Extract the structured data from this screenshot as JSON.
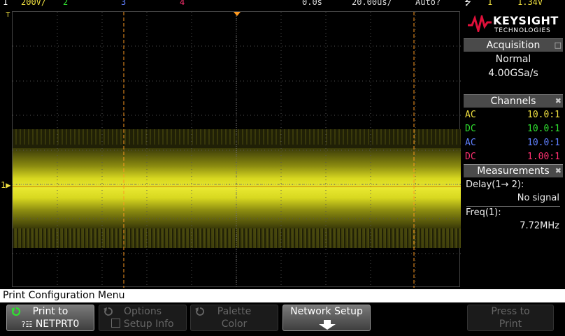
{
  "status": {
    "ch1_scale": "200V/",
    "ch2_label": "2",
    "ch3_label": "3",
    "ch4_label": "4",
    "delay": "0.0s",
    "timebase": "20.00us/",
    "trigger_mode": "Auto?",
    "trigger_source": "1",
    "trigger_level": "1.34V"
  },
  "brand": {
    "name": "KEYSIGHT",
    "sub": "TECHNOLOGIES"
  },
  "acquisition": {
    "title": "Acquisition",
    "mode": "Normal",
    "rate": "4.00GSa/s"
  },
  "channels": {
    "title": "Channels",
    "rows": [
      {
        "coupling": "AC",
        "probe": "10.0:1",
        "color": "#f0e040"
      },
      {
        "coupling": "DC",
        "probe": "10.0:1",
        "color": "#30e030"
      },
      {
        "coupling": "AC",
        "probe": "10.0:1",
        "color": "#6080ff"
      },
      {
        "coupling": "DC",
        "probe": "1.00:1",
        "color": "#ff3070"
      }
    ]
  },
  "measurements": {
    "title": "Measurements",
    "delay_label": "Delay(1→ 2):",
    "delay_value": "No signal",
    "freq_label": "Freq(1):",
    "freq_value": "7.72MHz"
  },
  "menu": {
    "title": "Print Configuration Menu",
    "print_to_label": "Print to",
    "print_to_value": "NETPRT0",
    "options_label": "Options",
    "setup_info_label": "Setup Info",
    "palette_label": "Palette",
    "palette_value": "Color",
    "network_setup_label": "Network Setup",
    "press_to_label": "Press to",
    "print_label": "Print"
  },
  "colors": {
    "ch1": "#f0e040",
    "ch2": "#30e030",
    "ch3": "#6080ff",
    "ch4": "#ff3070",
    "cursor": "#ff9a20"
  }
}
